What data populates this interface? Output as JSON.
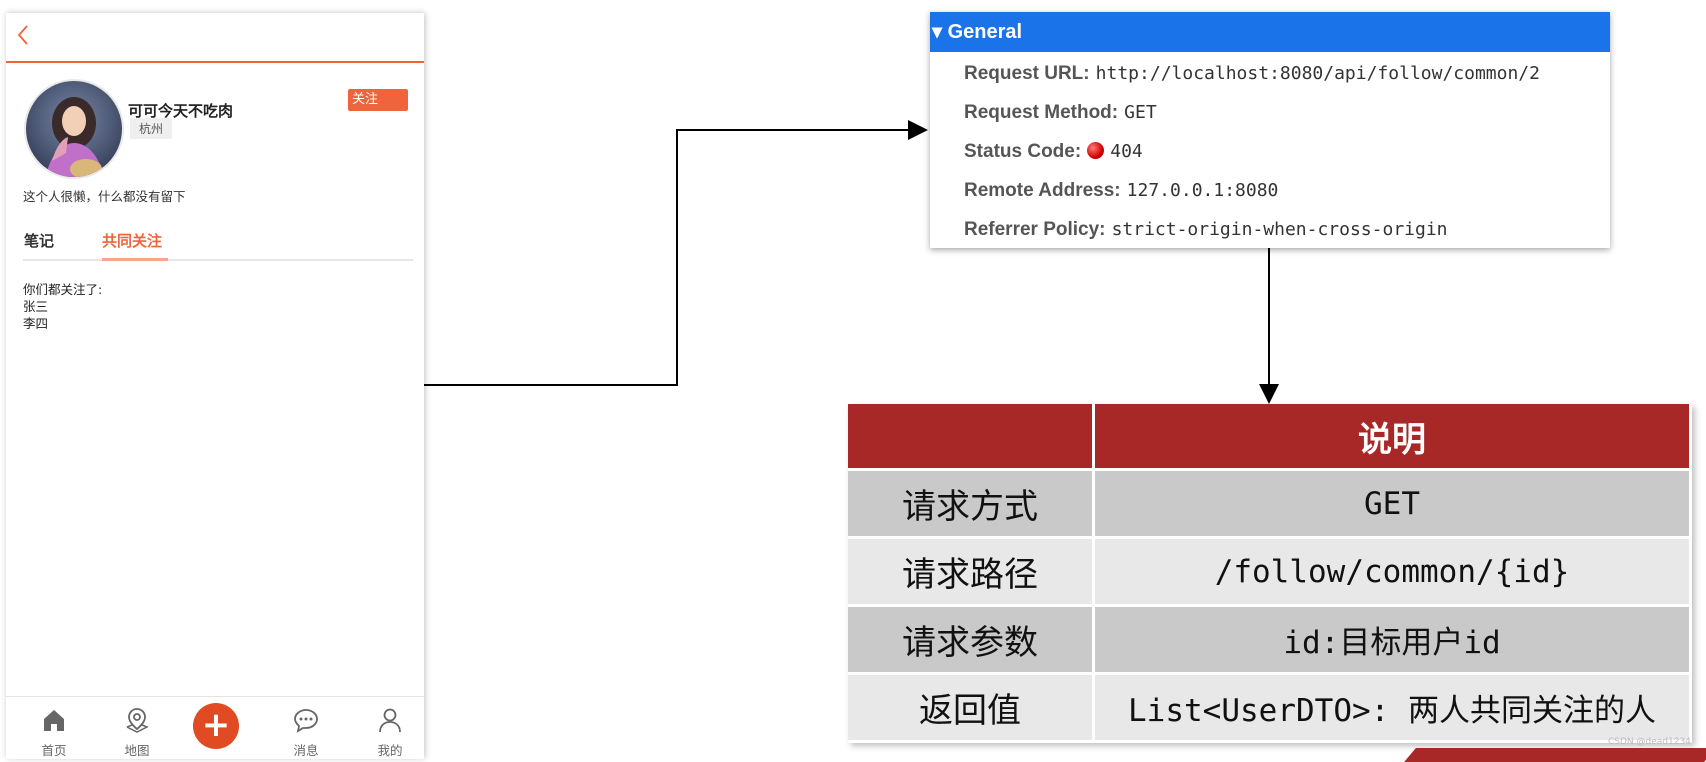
{
  "profile": {
    "username": "可可今天不吃肉",
    "city": "杭州",
    "follow_label": "关注",
    "intro": "这个人很懒，什么都没有留下"
  },
  "tabs": {
    "notes": "笔记",
    "common": "共同关注"
  },
  "common_follows": {
    "title": "你们都关注了:",
    "users": [
      "张三",
      "李四"
    ]
  },
  "bottom_nav": [
    {
      "label": "首页",
      "icon": "home-icon"
    },
    {
      "label": "地图",
      "icon": "map-pin-icon"
    },
    {
      "label": "+",
      "icon": "plus-icon"
    },
    {
      "label": "消息",
      "icon": "message-icon"
    },
    {
      "label": "我的",
      "icon": "user-icon"
    }
  ],
  "general": {
    "header": "General",
    "rows": [
      {
        "key": "Request URL:",
        "value": "http://localhost:8080/api/follow/common/2"
      },
      {
        "key": "Request Method:",
        "value": "GET"
      },
      {
        "key": "Status Code:",
        "value": "404"
      },
      {
        "key": "Remote Address:",
        "value": "127.0.0.1:8080"
      },
      {
        "key": "Referrer Policy:",
        "value": "strict-origin-when-cross-origin"
      }
    ]
  },
  "api_table": {
    "header": [
      "",
      "说明"
    ],
    "rows": [
      [
        "请求方式",
        "GET"
      ],
      [
        "请求路径",
        "/follow/common/{id}"
      ],
      [
        "请求参数",
        "id:目标用户id"
      ],
      [
        "返回值",
        "List<UserDTO>: 两人共同关注的人"
      ]
    ]
  },
  "watermark": "CSDN @dead1234",
  "colors": {
    "accent_orange": "#f0643c",
    "devtools_blue": "#1a73e8",
    "table_red": "#a82828",
    "status_red": "#d30000"
  }
}
